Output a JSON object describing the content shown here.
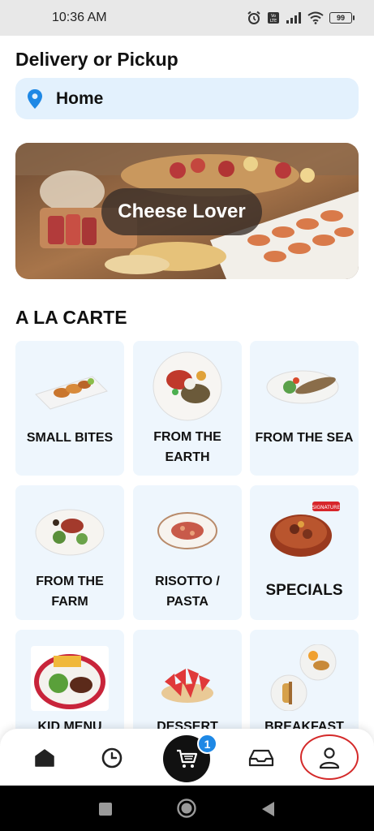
{
  "status_bar": {
    "time": "10:36 AM",
    "battery": "99",
    "icons": [
      "alarm-icon",
      "volte-icon",
      "signal-icon",
      "wifi-icon",
      "battery-icon"
    ]
  },
  "delivery": {
    "title": "Delivery or Pickup",
    "location": "Home",
    "location_icon": "location-pin-icon"
  },
  "banner": {
    "label": "Cheese Lover"
  },
  "menu": {
    "title": "A LA CARTE",
    "categories": [
      {
        "label": "SMALL BITES"
      },
      {
        "label": "FROM THE EARTH"
      },
      {
        "label": "FROM THE SEA"
      },
      {
        "label": "FROM THE FARM"
      },
      {
        "label": "RISOTTO / PASTA"
      },
      {
        "label": "SPECIALS"
      },
      {
        "label": "KID MENU"
      },
      {
        "label": "DESSERT"
      },
      {
        "label": "BREAKFAST"
      }
    ]
  },
  "bottom_nav": {
    "items": [
      "home-icon",
      "history-icon",
      "cart-icon",
      "inbox-icon",
      "profile-icon"
    ],
    "cart_count": "1"
  },
  "colors": {
    "accent_blue": "#1e88e5",
    "card_bg": "#eef6fd",
    "location_bg": "#e3f1fd",
    "highlight_ring": "#d42a2a"
  }
}
